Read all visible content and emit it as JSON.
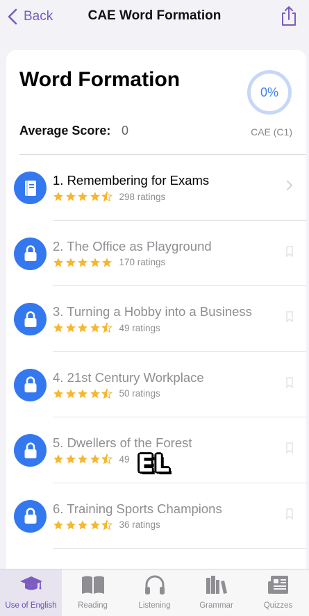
{
  "nav": {
    "back_label": "Back",
    "title": "CAE Word Formation"
  },
  "card": {
    "title": "Word Formation",
    "progress": "0%",
    "progress_fraction": 0,
    "average_label": "Average Score:",
    "average_value": "0",
    "level": "CAE (C1)"
  },
  "lessons": [
    {
      "title": "1. Remembering for Exams",
      "rating": 4.5,
      "ratings_text": "298 ratings",
      "locked": false
    },
    {
      "title": "2. The Office as Playground",
      "rating": 5,
      "ratings_text": "170 ratings",
      "locked": true
    },
    {
      "title": "3. Turning a Hobby into a Business",
      "rating": 4.5,
      "ratings_text": "49 ratings",
      "locked": true
    },
    {
      "title": "4. 21st Century Workplace",
      "rating": 4.5,
      "ratings_text": "50 ratings",
      "locked": true
    },
    {
      "title": "5. Dwellers of the Forest",
      "rating": 4.5,
      "ratings_text": "49",
      "locked": true
    },
    {
      "title": "6. Training Sports Champions",
      "rating": 4.5,
      "ratings_text": "36 ratings",
      "locked": true
    }
  ],
  "caption": "EL",
  "tabs": [
    {
      "label": "Use of English",
      "icon": "graduation-cap-icon",
      "active": true
    },
    {
      "label": "Reading",
      "icon": "book-icon",
      "active": false
    },
    {
      "label": "Listening",
      "icon": "headphones-icon",
      "active": false
    },
    {
      "label": "Grammar",
      "icon": "books-icon",
      "active": false
    },
    {
      "label": "Quizzes",
      "icon": "newspaper-icon",
      "active": false
    }
  ],
  "colors": {
    "accent": "#7b5cc0",
    "lesson_circle": "#3478f0",
    "star": "#f5b731",
    "progress_ring": "#c7d7f5"
  }
}
